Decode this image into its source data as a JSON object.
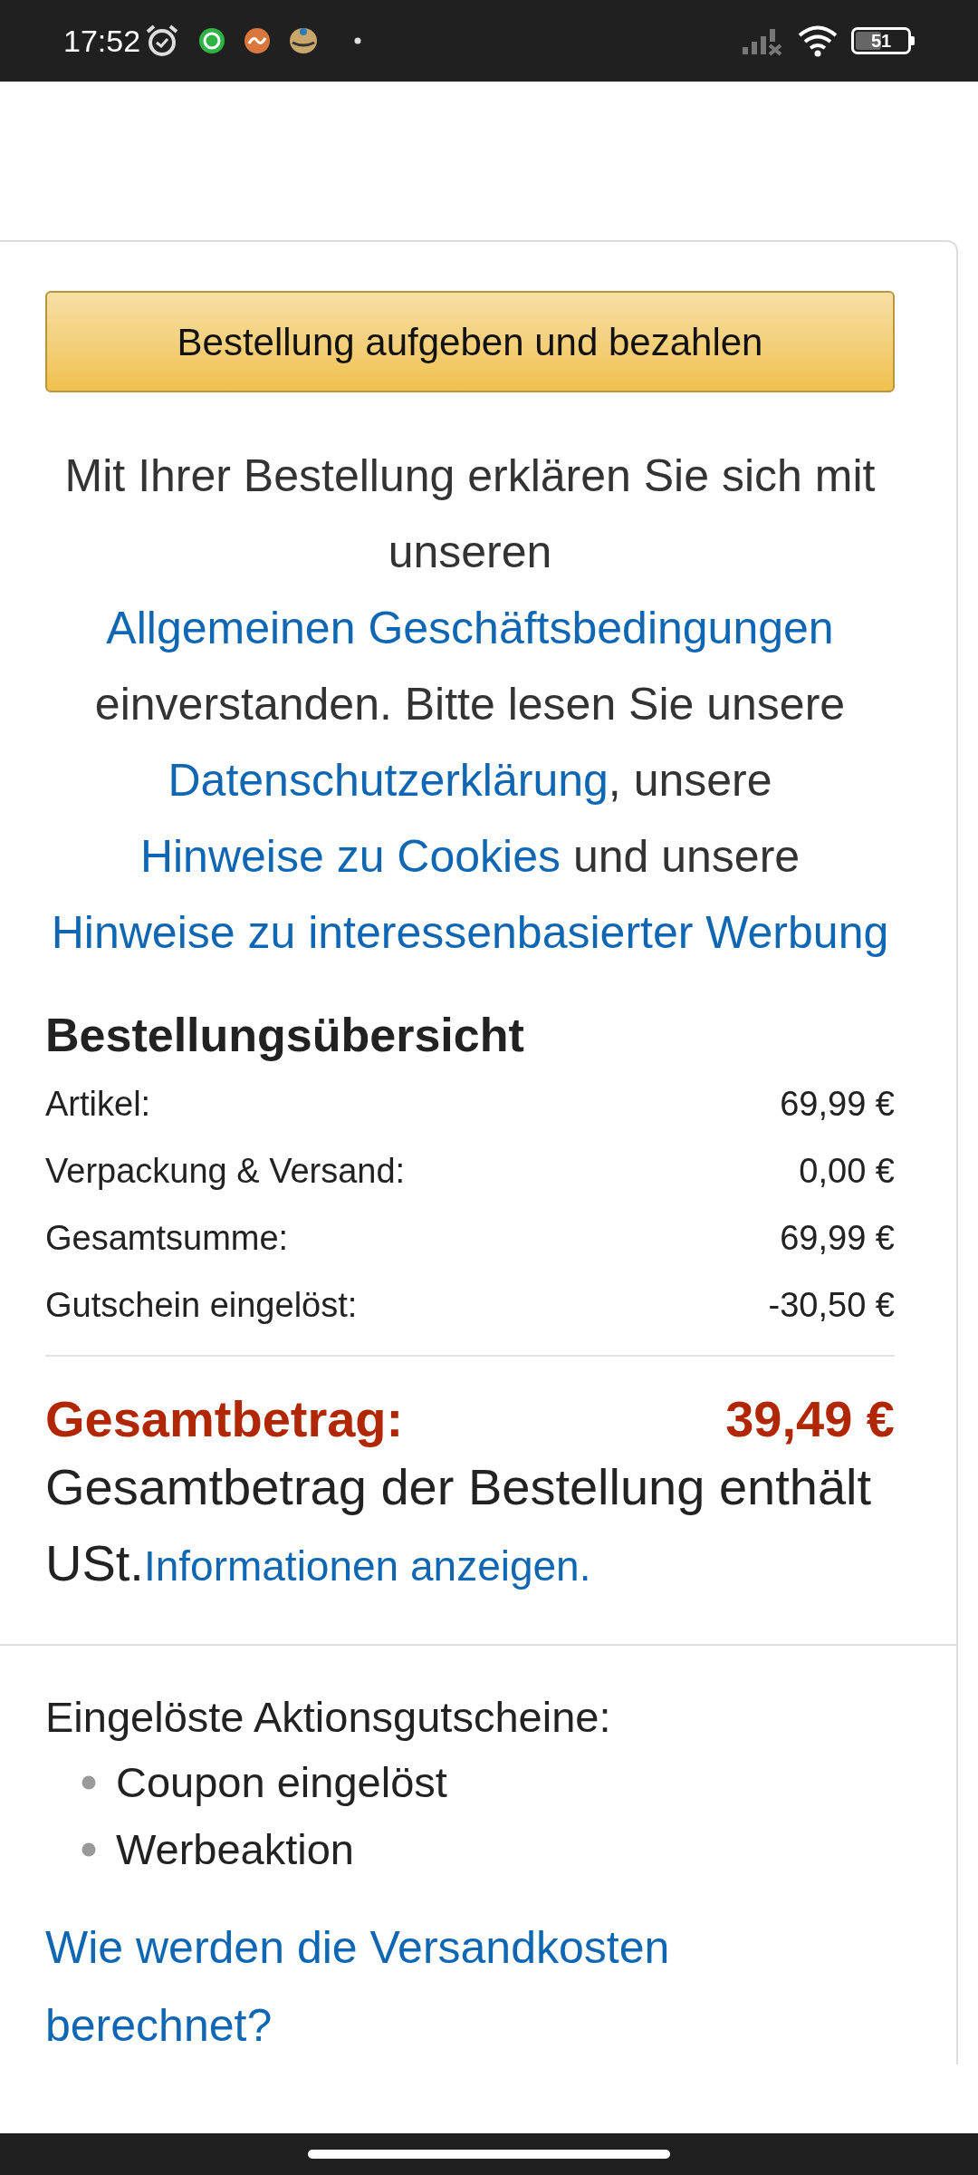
{
  "status_bar": {
    "time": "17:52",
    "battery": "51"
  },
  "place_order_button": "Bestellung aufgeben und bezahlen",
  "legal_notice": [
    {
      "text": "Mit Ihrer Bestellung erklären Sie sich mit unseren",
      "link": false
    },
    {
      "text": "Allgemeinen Geschäftsbedingungen",
      "link": true
    },
    {
      "text": "einverstanden. Bitte lesen Sie unsere",
      "link": false
    },
    {
      "text": "Datenschutzerklärung",
      "link": true
    },
    {
      "text": ", unsere",
      "link": false
    },
    {
      "text": "Hinweise zu Cookies",
      "link": true
    },
    {
      "text": "und unsere",
      "link": false
    },
    {
      "text": "Hinweise zu interessenbasierter Werbung",
      "link": true
    }
  ],
  "order_summary": {
    "title": "Bestellungsübersicht",
    "rows": [
      {
        "label": "Artikel:",
        "value": "69,99 €"
      },
      {
        "label": "Verpackung & Versand:",
        "value": "0,00 €"
      },
      {
        "label": "Gesamtsumme:",
        "value": "69,99 €"
      },
      {
        "label": "Gutschein eingelöst:",
        "value": "-30,50 €"
      }
    ],
    "total": {
      "label": "Gesamtbetrag:",
      "value": "39,49 €"
    },
    "vat_note": "Gesamtbetrag der Bestellung enthält USt.",
    "vat_link": "Informationen anzeigen."
  },
  "promotions": {
    "title": "Eingelöste Aktionsgutscheine:",
    "items": [
      "Coupon eingelöst",
      "Werbeaktion"
    ]
  },
  "shipping_link": "Wie werden die Versandkosten berechnet?"
}
